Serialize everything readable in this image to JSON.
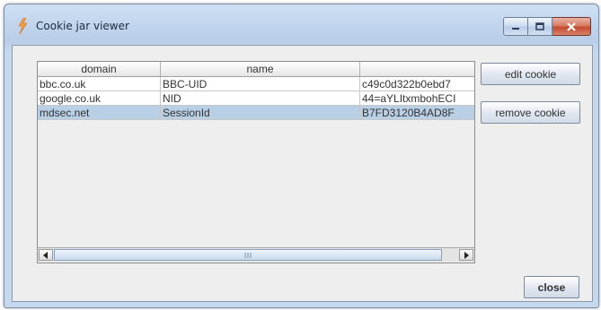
{
  "window": {
    "title": "Cookie jar viewer"
  },
  "table": {
    "columns": [
      "domain",
      "name",
      ""
    ],
    "rows": [
      {
        "domain": "bbc.co.uk",
        "name": "BBC-UID",
        "value": "c49c0d322b0ebd7"
      },
      {
        "domain": "google.co.uk",
        "name": "NID",
        "value": "44=aYLItxmbohECI"
      },
      {
        "domain": "mdsec.net",
        "name": "SessionId",
        "value": "B7FD3120B4AD8F"
      }
    ],
    "selected_row": 2,
    "scrollbar_grip": "|||"
  },
  "buttons": {
    "edit_label": "edit cookie",
    "remove_label": "remove cookie",
    "close_label": "close"
  }
}
